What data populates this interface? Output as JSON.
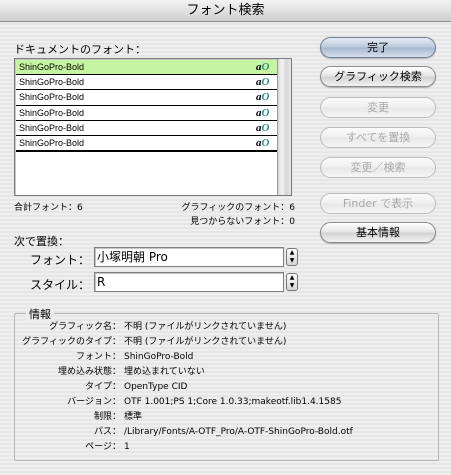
{
  "window": {
    "title": "フォント検索"
  },
  "fonts_section": {
    "label": "ドキュメントのフォント：",
    "fonts": [
      {
        "name": "ShinGoPro-Bold",
        "selected": true
      },
      {
        "name": "ShinGoPro-Bold",
        "selected": false
      },
      {
        "name": "ShinGoPro-Bold",
        "selected": false
      },
      {
        "name": "ShinGoPro-Bold",
        "selected": false
      },
      {
        "name": "ShinGoPro-Bold",
        "selected": false
      },
      {
        "name": "ShinGoPro-Bold",
        "selected": false
      }
    ],
    "icon": "opentype-font-icon",
    "icon_glyph_a": "a",
    "icon_glyph_o": "O",
    "total_label": "合計フォント：6",
    "graphic_fonts_label": "グラフィックのフォント：6",
    "missing_fonts_label": "見つからないフォント：0"
  },
  "buttons": {
    "done": "完了",
    "find_graphic": "グラフィック検索",
    "change": "変更",
    "change_all": "すべてを置換",
    "change_find": "変更／検索",
    "reveal_finder": "Finder で表示",
    "more_info": "基本情報"
  },
  "replace": {
    "section_label": "次で置換：",
    "font_label": "フォント：",
    "font_value": "小塚明朝 Pro",
    "style_label": "スタイル：",
    "style_value": "R"
  },
  "info": {
    "title": "情報",
    "rows": [
      {
        "key": "グラフィック名：",
        "value": "不明 (ファイルがリンクされていません)"
      },
      {
        "key": "グラフィックのタイプ：",
        "value": "不明 (ファイルがリンクされていません)"
      },
      {
        "key": "フォント：",
        "value": "ShinGoPro-Bold"
      },
      {
        "key": "埋め込み状態：",
        "value": "埋め込まれていない"
      },
      {
        "key": "タイプ：",
        "value": "OpenType CID"
      },
      {
        "key": "バージョン：",
        "value": "OTF 1.001;PS 1;Core 1.0.33;makeotf.lib1.4.1585"
      },
      {
        "key": "制限：",
        "value": "標準"
      },
      {
        "key": "パス：",
        "value": "/Library/Fonts/A-OTF_Pro/A-OTF-ShinGoPro-Bold.otf"
      },
      {
        "key": "ページ：",
        "value": "1"
      }
    ]
  },
  "colors": {
    "selection": "#c6f5a2",
    "default_button": "#a5b6cc"
  }
}
